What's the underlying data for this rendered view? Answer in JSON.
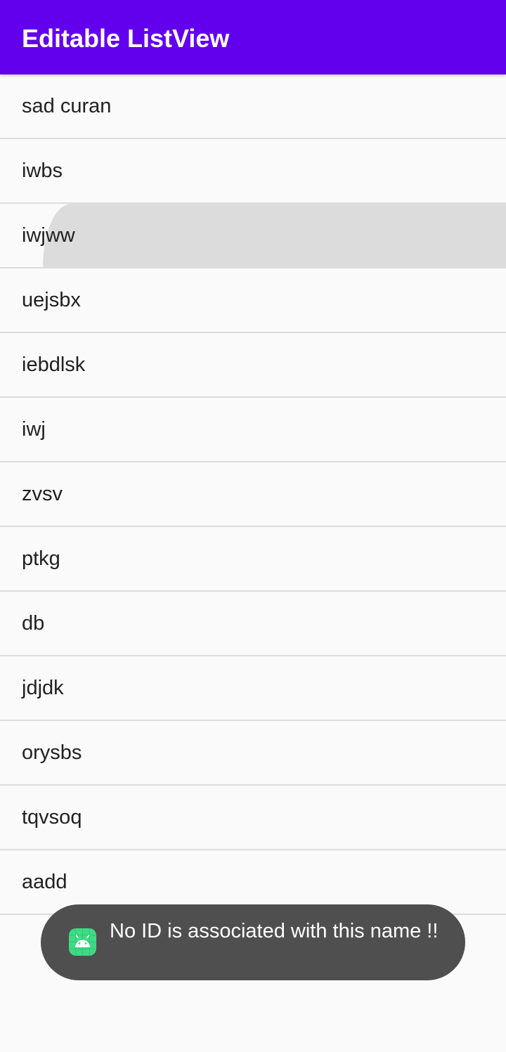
{
  "toolbar": {
    "title": "Editable ListView"
  },
  "list": {
    "items": [
      {
        "label": "sad curan"
      },
      {
        "label": "iwbs"
      },
      {
        "label": "iwjww"
      },
      {
        "label": "uejsbx"
      },
      {
        "label": "iebdlsk"
      },
      {
        "label": "iwj"
      },
      {
        "label": "zvsv"
      },
      {
        "label": "ptkg"
      },
      {
        "label": "db"
      },
      {
        "label": "jdjdk"
      },
      {
        "label": "orysbs"
      },
      {
        "label": "tqvsoq"
      },
      {
        "label": "aadd"
      }
    ]
  },
  "toast": {
    "icon": "android-app-icon",
    "message": "No ID is associated with this name !!"
  },
  "colors": {
    "primary": "#6200ee",
    "background": "#fafafa",
    "divider": "#dcdcdc",
    "toast_background": "#4f4f4f",
    "android_green": "#3ddc84"
  }
}
